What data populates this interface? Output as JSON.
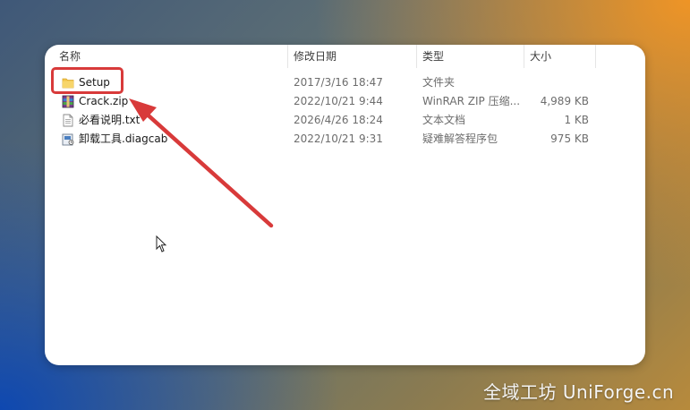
{
  "columns": {
    "name": "名称",
    "date": "修改日期",
    "type": "类型",
    "size": "大小"
  },
  "files": [
    {
      "name": "Setup",
      "date": "2017/3/16 18:47",
      "type": "文件夹",
      "size": "",
      "icon": "folder-icon"
    },
    {
      "name": "Crack.zip",
      "date": "2022/10/21 9:44",
      "type": "WinRAR ZIP 压缩...",
      "size": "4,989 KB",
      "icon": "winrar-archive-icon"
    },
    {
      "name": "必看说明.txt",
      "date": "2026/4/26 18:24",
      "type": "文本文档",
      "size": "1 KB",
      "icon": "text-file-icon"
    },
    {
      "name": "卸载工具.diagcab",
      "date": "2022/10/21 9:31",
      "type": "疑难解答程序包",
      "size": "975 KB",
      "icon": "diagcab-package-icon"
    }
  ],
  "watermark": "全域工坊 UniForge.cn",
  "colors": {
    "highlight": "#d83a3a",
    "folder": "#f3c54a"
  }
}
